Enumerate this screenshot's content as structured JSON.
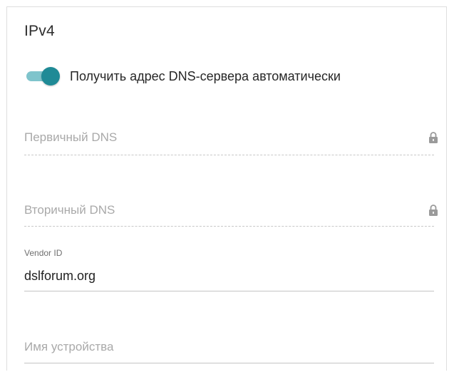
{
  "section": {
    "title": "IPv4"
  },
  "dns_auto": {
    "label": "Получить адрес DNS-сервера автоматически",
    "enabled": true,
    "color": "#1f8a96"
  },
  "fields": {
    "primary_dns": {
      "placeholder": "Первичный DNS",
      "locked": true,
      "icon": "lock-icon"
    },
    "secondary_dns": {
      "placeholder": "Вторичный DNS",
      "locked": true,
      "icon": "lock-icon"
    },
    "vendor_id": {
      "label": "Vendor ID",
      "value": "dslforum.org"
    },
    "device_name": {
      "placeholder": "Имя устройства"
    }
  }
}
